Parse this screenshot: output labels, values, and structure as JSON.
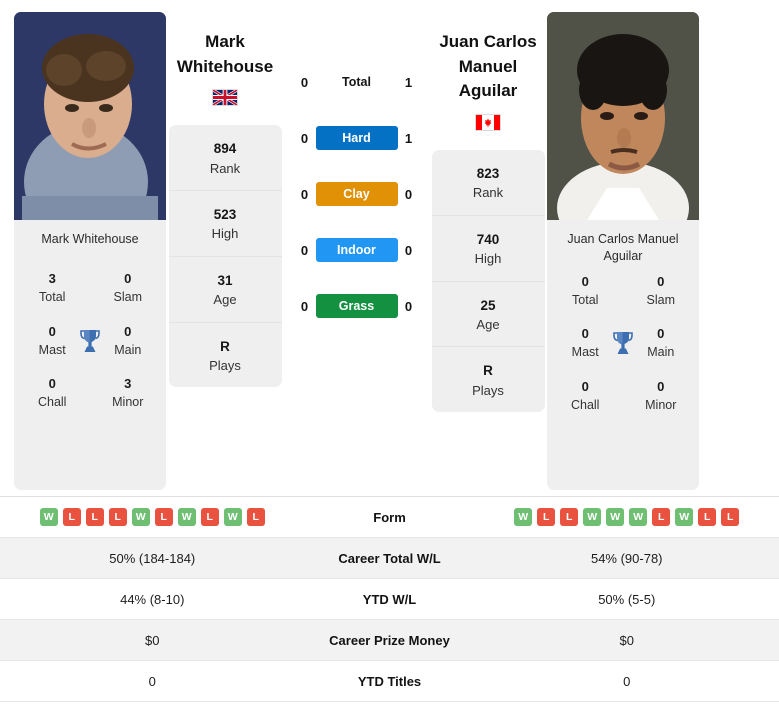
{
  "players": {
    "left": {
      "name": "Mark Whitehouse",
      "name_line1": "Mark",
      "name_line2": "Whitehouse",
      "flag": "gb-flag",
      "photo_caption": "Mark Whitehouse",
      "stats": [
        {
          "value": "894",
          "label": "Rank"
        },
        {
          "value": "523",
          "label": "High"
        },
        {
          "value": "31",
          "label": "Age"
        },
        {
          "value": "R",
          "label": "Plays"
        }
      ],
      "titles": [
        {
          "value": "3",
          "label": "Total"
        },
        {
          "value": "0",
          "label": "Slam"
        },
        {
          "value": "0",
          "label": "Mast"
        },
        {
          "value": "0",
          "label": "Main"
        },
        {
          "value": "0",
          "label": "Chall"
        },
        {
          "value": "3",
          "label": "Minor"
        }
      ],
      "form": [
        "W",
        "L",
        "L",
        "L",
        "W",
        "L",
        "W",
        "L",
        "W",
        "L"
      ],
      "career_total_wl": "50% (184-184)",
      "ytd_wl": "44% (8-10)",
      "career_prize_money": "$0",
      "ytd_titles": "0"
    },
    "right": {
      "name": "Juan Carlos Manuel Aguilar",
      "name_line1": "Juan Carlos",
      "name_line2": "Manuel Aguilar",
      "flag": "ca-flag",
      "photo_caption": "Juan Carlos Manuel Aguilar",
      "stats": [
        {
          "value": "823",
          "label": "Rank"
        },
        {
          "value": "740",
          "label": "High"
        },
        {
          "value": "25",
          "label": "Age"
        },
        {
          "value": "R",
          "label": "Plays"
        }
      ],
      "titles": [
        {
          "value": "0",
          "label": "Total"
        },
        {
          "value": "0",
          "label": "Slam"
        },
        {
          "value": "0",
          "label": "Mast"
        },
        {
          "value": "0",
          "label": "Main"
        },
        {
          "value": "0",
          "label": "Chall"
        },
        {
          "value": "0",
          "label": "Minor"
        }
      ],
      "form": [
        "W",
        "L",
        "L",
        "W",
        "W",
        "W",
        "L",
        "W",
        "L",
        "L"
      ],
      "career_total_wl": "54% (90-78)",
      "ytd_wl": "50% (5-5)",
      "career_prize_money": "$0",
      "ytd_titles": "0"
    }
  },
  "head_to_head": [
    {
      "label": "Total",
      "left": "0",
      "right": "1",
      "style": "plain",
      "color": ""
    },
    {
      "label": "Hard",
      "left": "0",
      "right": "1",
      "style": "bar",
      "color": "#0571c4"
    },
    {
      "label": "Clay",
      "left": "0",
      "right": "0",
      "style": "bar",
      "color": "#e09106"
    },
    {
      "label": "Indoor",
      "left": "0",
      "right": "0",
      "style": "bar",
      "color": "#2196f3"
    },
    {
      "label": "Grass",
      "left": "0",
      "right": "0",
      "style": "bar",
      "color": "#139141"
    }
  ],
  "comparison_rows": [
    {
      "label": "Form",
      "left": "",
      "right": "",
      "type": "form"
    },
    {
      "label": "Career Total W/L",
      "left": "50% (184-184)",
      "right": "54% (90-78)",
      "type": "text"
    },
    {
      "label": "YTD W/L",
      "left": "44% (8-10)",
      "right": "50% (5-5)",
      "type": "text"
    },
    {
      "label": "Career Prize Money",
      "left": "$0",
      "right": "$0",
      "type": "text"
    },
    {
      "label": "YTD Titles",
      "left": "0",
      "right": "0",
      "type": "text"
    }
  ],
  "icons": {
    "trophy": "trophy-icon"
  },
  "colors": {
    "hard": "#0571c4",
    "clay": "#e09106",
    "indoor": "#2196f3",
    "grass": "#139141",
    "win_badge": "#6fbf73",
    "loss_badge": "#e8523f",
    "panel": "#efefef"
  }
}
